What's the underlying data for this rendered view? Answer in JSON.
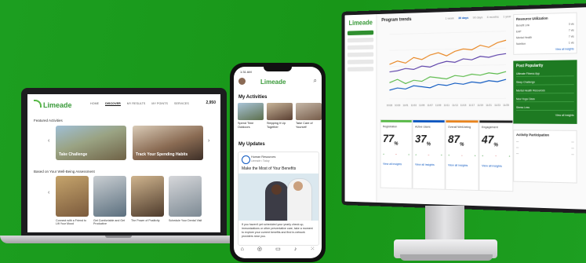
{
  "brand": "Limeade",
  "colors": {
    "background": "#1a9a1f",
    "brand_green": "#58b947",
    "accent_blue": "#0a56c0"
  },
  "laptop": {
    "nav": [
      "HOME",
      "DISCOVER",
      "MY RESULTS",
      "MY POINTS",
      "SERVICES"
    ],
    "active_nav": "DISCOVER",
    "points": "2,950",
    "featured_heading": "Featured Activities",
    "featured": [
      {
        "label": "Take Challenge"
      },
      {
        "label": "Track Your Spending Habits"
      }
    ],
    "assessment_heading": "Based on Your Well-Being Assessment",
    "tiles": [
      {
        "label": "Connect with a Friend to Lift Your Mood"
      },
      {
        "label": "Get Comfortable and Get Productive"
      },
      {
        "label": "The Power of Positivity"
      },
      {
        "label": "Schedule Your Dental Visit"
      }
    ]
  },
  "phone": {
    "time": "1:31 AM",
    "activities_heading": "My Activities",
    "activities": [
      {
        "label": "Spend Time Outdoors"
      },
      {
        "label": "Stepping It Up Together"
      },
      {
        "label": "Take Care of Yourself"
      }
    ],
    "updates_heading": "My Updates",
    "update": {
      "org": "Human Resources",
      "meta": "Limeade • Today",
      "title": "Make the Most of Your Benefits",
      "body": "If you haven't yet scheduled your yearly check up, immunizations or other preventative care, take a moment to explore your current benefits and find in-network providers near you."
    },
    "tabbar_icons": [
      "home-icon",
      "discover-icon",
      "messages-icon",
      "bell-icon",
      "grid-icon"
    ]
  },
  "dashboard": {
    "title": "Program trends",
    "filters": [
      "1 week",
      "30 days",
      "90 days",
      "6 months",
      "1 year"
    ],
    "active_filter": "30 days",
    "resource_title": "Resource Utilization",
    "resource_rows": [
      {
        "name": "Benefit Link",
        "value": "3 vis"
      },
      {
        "name": "EAP",
        "value": "7 vis"
      },
      {
        "name": "Mental Health",
        "value": "7 vis"
      },
      {
        "name": "Nutrition",
        "value": "1 vis"
      }
    ],
    "popularity_title": "Post Popularity",
    "popularity_rows": [
      "Ultimate Fitness App",
      "Sleep Challenge",
      "Mental Health Resources",
      "New Yoga Class",
      "Stress Less"
    ],
    "view_all": "View all insights",
    "participation_title": "Activity Participation",
    "cards": [
      {
        "label": "Registration",
        "value": "77",
        "color": "#58b947"
      },
      {
        "label": "Active Users",
        "value": "37",
        "color": "#0a56c0"
      },
      {
        "label": "Overall Well-being",
        "value": "87",
        "color": "#e8841e"
      },
      {
        "label": "Engagement",
        "value": "47",
        "color": "#222222"
      }
    ]
  },
  "chart_data": {
    "type": "line",
    "title": "Program trends",
    "x": [
      "10/28",
      "10/30",
      "11/01",
      "11/03",
      "11/05",
      "11/07",
      "11/09",
      "11/11",
      "11/13",
      "11/15",
      "11/17",
      "11/19",
      "11/21",
      "11/23",
      "11/25"
    ],
    "series": [
      {
        "values": [
          72,
          75,
          73,
          78,
          76,
          80,
          82,
          79,
          83,
          85,
          84,
          88,
          86,
          90,
          92
        ],
        "color": "#e8841e"
      },
      {
        "values": [
          65,
          66,
          68,
          67,
          70,
          69,
          72,
          74,
          73,
          76,
          75,
          78,
          77,
          79,
          80
        ],
        "color": "#5a3ea8"
      },
      {
        "values": [
          55,
          58,
          54,
          57,
          56,
          60,
          59,
          58,
          61,
          60,
          62,
          61,
          63,
          62,
          64
        ],
        "color": "#58b947"
      },
      {
        "values": [
          48,
          50,
          49,
          52,
          51,
          50,
          53,
          52,
          54,
          53,
          55,
          54,
          56,
          55,
          57
        ],
        "color": "#0a56c0"
      }
    ],
    "ylim": [
      40,
      100
    ]
  }
}
